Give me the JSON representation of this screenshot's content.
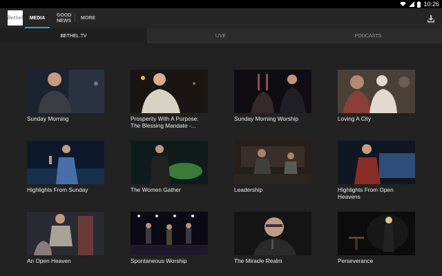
{
  "status_bar": {
    "time": "10:26",
    "icons": [
      "wifi-icon",
      "cellular-signal-icon",
      "battery-icon"
    ]
  },
  "app_bar": {
    "logo_text": "Bethel",
    "nav": [
      {
        "label": "MEDIA",
        "active": true
      },
      {
        "label": "GOOD NEWS",
        "active": false
      },
      {
        "label": "MORE",
        "active": false
      }
    ],
    "download_icon": "download-icon"
  },
  "tabs": [
    {
      "label": "BETHEL.TV",
      "active": true
    },
    {
      "label": "LIVE",
      "active": false
    },
    {
      "label": "PODCASTS",
      "active": false
    }
  ],
  "colors": {
    "accent": "#2aa8d8",
    "background": "#222222",
    "app_bar": "#262626",
    "tab_bar": "#2c2c2c"
  },
  "videos": [
    {
      "title": "Sunday Morning"
    },
    {
      "title": "Prosperity With A Purpose: The Blessing Mandate -..."
    },
    {
      "title": "Sunday Morning Worship"
    },
    {
      "title": "Loving A City"
    },
    {
      "title": "Highlights From Sunday"
    },
    {
      "title": "The Women Gather"
    },
    {
      "title": "Leadership"
    },
    {
      "title": "Highlights From Open Heavens"
    },
    {
      "title": "An Open Heaven"
    },
    {
      "title": "Spontaneous Worship"
    },
    {
      "title": "The Miracle Realm"
    },
    {
      "title": "Perseverance"
    }
  ]
}
